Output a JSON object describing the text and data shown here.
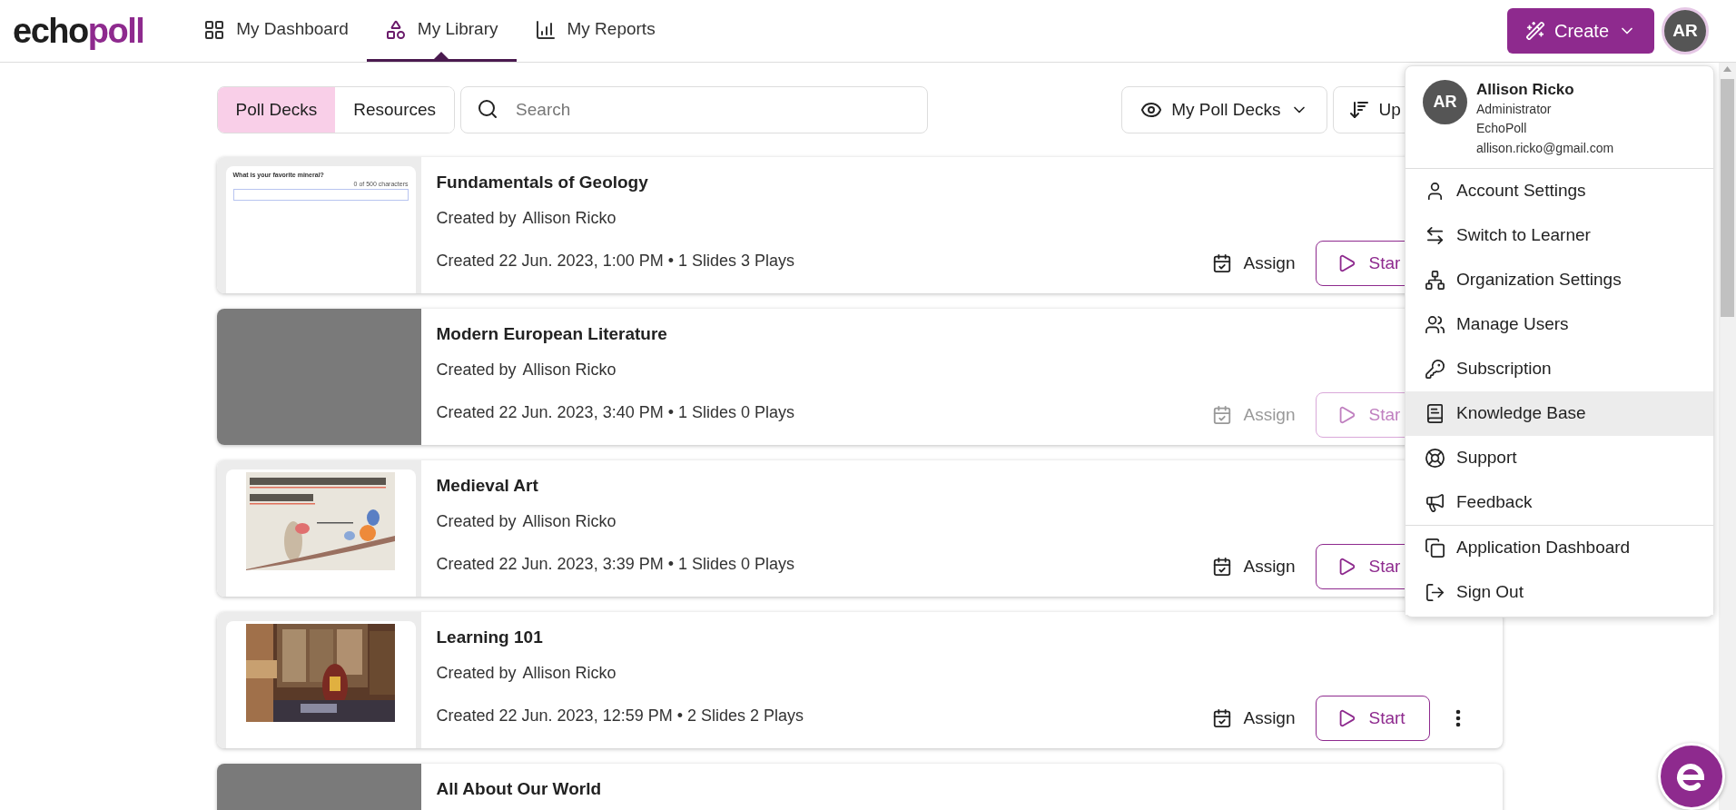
{
  "header": {
    "logo": {
      "dark": "echo",
      "accent": "poll"
    },
    "nav": [
      {
        "label": "My Dashboard",
        "selected": false
      },
      {
        "label": "My Library",
        "selected": true
      },
      {
        "label": "My Reports",
        "selected": false
      }
    ],
    "create_button": "Create",
    "avatar": "AR"
  },
  "toolbar": {
    "segments": [
      {
        "label": "Poll Decks",
        "selected": true
      },
      {
        "label": "Resources",
        "selected": false
      }
    ],
    "search": {
      "placeholder": "Search"
    },
    "filter": "My Poll Decks",
    "sort": "Up"
  },
  "decks": [
    {
      "title": "Fundamentals of Geology",
      "created_by": "Created by",
      "author": "Allison Ricko",
      "meta": "Created 22 Jun. 2023, 1:00 PM • 1 Slides 3 Plays",
      "thumbnail": {
        "kind": "slide",
        "question": "What is your favorite mineral?",
        "counter": "0 of 500 characters"
      },
      "disabled": false,
      "assign": "Assign",
      "start": "Star"
    },
    {
      "title": "Modern European Literature",
      "created_by": "Created by",
      "author": "Allison Ricko",
      "meta": "Created 22 Jun. 2023, 3:40 PM • 1 Slides 0 Plays",
      "thumbnail": {
        "kind": "blank"
      },
      "disabled": true,
      "assign": "Assign",
      "start": "Star"
    },
    {
      "title": "Medieval Art",
      "created_by": "Created by",
      "author": "Allison Ricko",
      "meta": "Created 22 Jun. 2023, 3:39 PM • 1 Slides 0 Plays",
      "thumbnail": {
        "kind": "manuscript"
      },
      "disabled": false,
      "assign": "Assign",
      "start": "Star"
    },
    {
      "title": "Learning 101",
      "created_by": "Created by",
      "author": "Allison Ricko",
      "meta": "Created 22 Jun. 2023, 12:59 PM • 2 Slides 2 Plays",
      "thumbnail": {
        "kind": "bookstore"
      },
      "disabled": false,
      "assign": "Assign",
      "start": "Start",
      "more_options": true
    },
    {
      "title": "All About Our World",
      "thumbnail": {
        "kind": "blank"
      }
    }
  ],
  "account_menu": {
    "avatar": "AR",
    "name": "Allison Ricko",
    "role": "Administrator",
    "organization": "EchoPoll",
    "email": "allison.ricko@gmail.com",
    "groups": [
      [
        {
          "label": "Account Settings",
          "highlighted": false
        },
        {
          "label": "Switch to Learner",
          "highlighted": false
        },
        {
          "label": "Organization Settings",
          "highlighted": false
        },
        {
          "label": "Manage Users",
          "highlighted": false
        },
        {
          "label": "Subscription",
          "highlighted": false
        },
        {
          "label": "Knowledge Base",
          "highlighted": true
        },
        {
          "label": "Support",
          "highlighted": false
        },
        {
          "label": "Feedback",
          "highlighted": false
        }
      ],
      [
        {
          "label": "Application Dashboard",
          "highlighted": false
        },
        {
          "label": "Sign Out",
          "highlighted": false
        }
      ]
    ]
  }
}
